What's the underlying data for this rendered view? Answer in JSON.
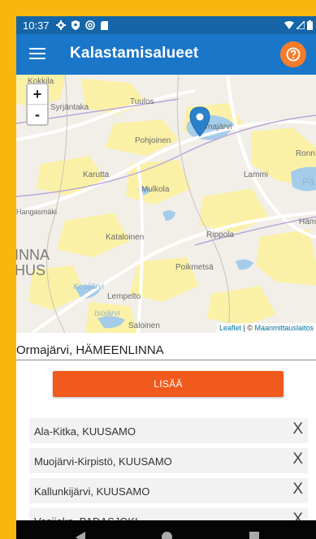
{
  "status_bar": {
    "time": "10:37",
    "left_icons": [
      "settings-icon",
      "shield-icon",
      "at-sign-icon",
      "sim-card-icon"
    ],
    "right_icons": [
      "wifi-icon",
      "signal-icon",
      "battery-icon"
    ]
  },
  "app_bar": {
    "title": "Kalastamisalueet",
    "menu_icon": "hamburger-menu-icon",
    "help_icon": "help-icon"
  },
  "map": {
    "zoom_in": "+",
    "zoom_out": "-",
    "place_labels": [
      "Kokkila",
      "Syrjäntaka",
      "Tuulos",
      "Ormajärvi",
      "Pohjoinen",
      "Ronn",
      "Karutta",
      "Mulkola",
      "Lammi",
      "Pä",
      "Hangasmäki",
      "Häme",
      "Kataloinen",
      "Rippola",
      "INNA",
      "HUS",
      "Poikmetsä",
      "Kesijärvi",
      "Lempelto",
      "Isojärvi",
      "Saloinen"
    ],
    "attribution_leaflet": "Leaflet",
    "attribution_separator": " | © ",
    "attribution_source": "Maanmittauslaitos",
    "marker_icon": "map-pin-icon",
    "colors": {
      "water": "#a5cdea",
      "fields": "#fbf1a6",
      "roads": "#ffffff",
      "land": "#f2efe9"
    }
  },
  "location_field": {
    "value": "Ormajärvi, HÄMEENLINNA"
  },
  "add_button": {
    "label": "LISÄÄ",
    "color": "#f05a1c"
  },
  "areas": [
    {
      "name": "Ala-Kitka, KUUSAMO",
      "remove": "X"
    },
    {
      "name": "Muojärvi-Kirpistö, KUUSAMO",
      "remove": "X"
    },
    {
      "name": "Kallunkijärvi, KUUSAMO",
      "remove": "X"
    },
    {
      "name": "Vesijako, PADASJOKI",
      "remove": "X"
    }
  ],
  "nav_bar": {
    "icons": [
      "back-icon",
      "home-icon",
      "recents-icon"
    ]
  },
  "colors": {
    "appbar": "#1976c9",
    "statusbar": "#1565a8",
    "accent": "#f57c2b",
    "frame": "#f7b70f"
  }
}
